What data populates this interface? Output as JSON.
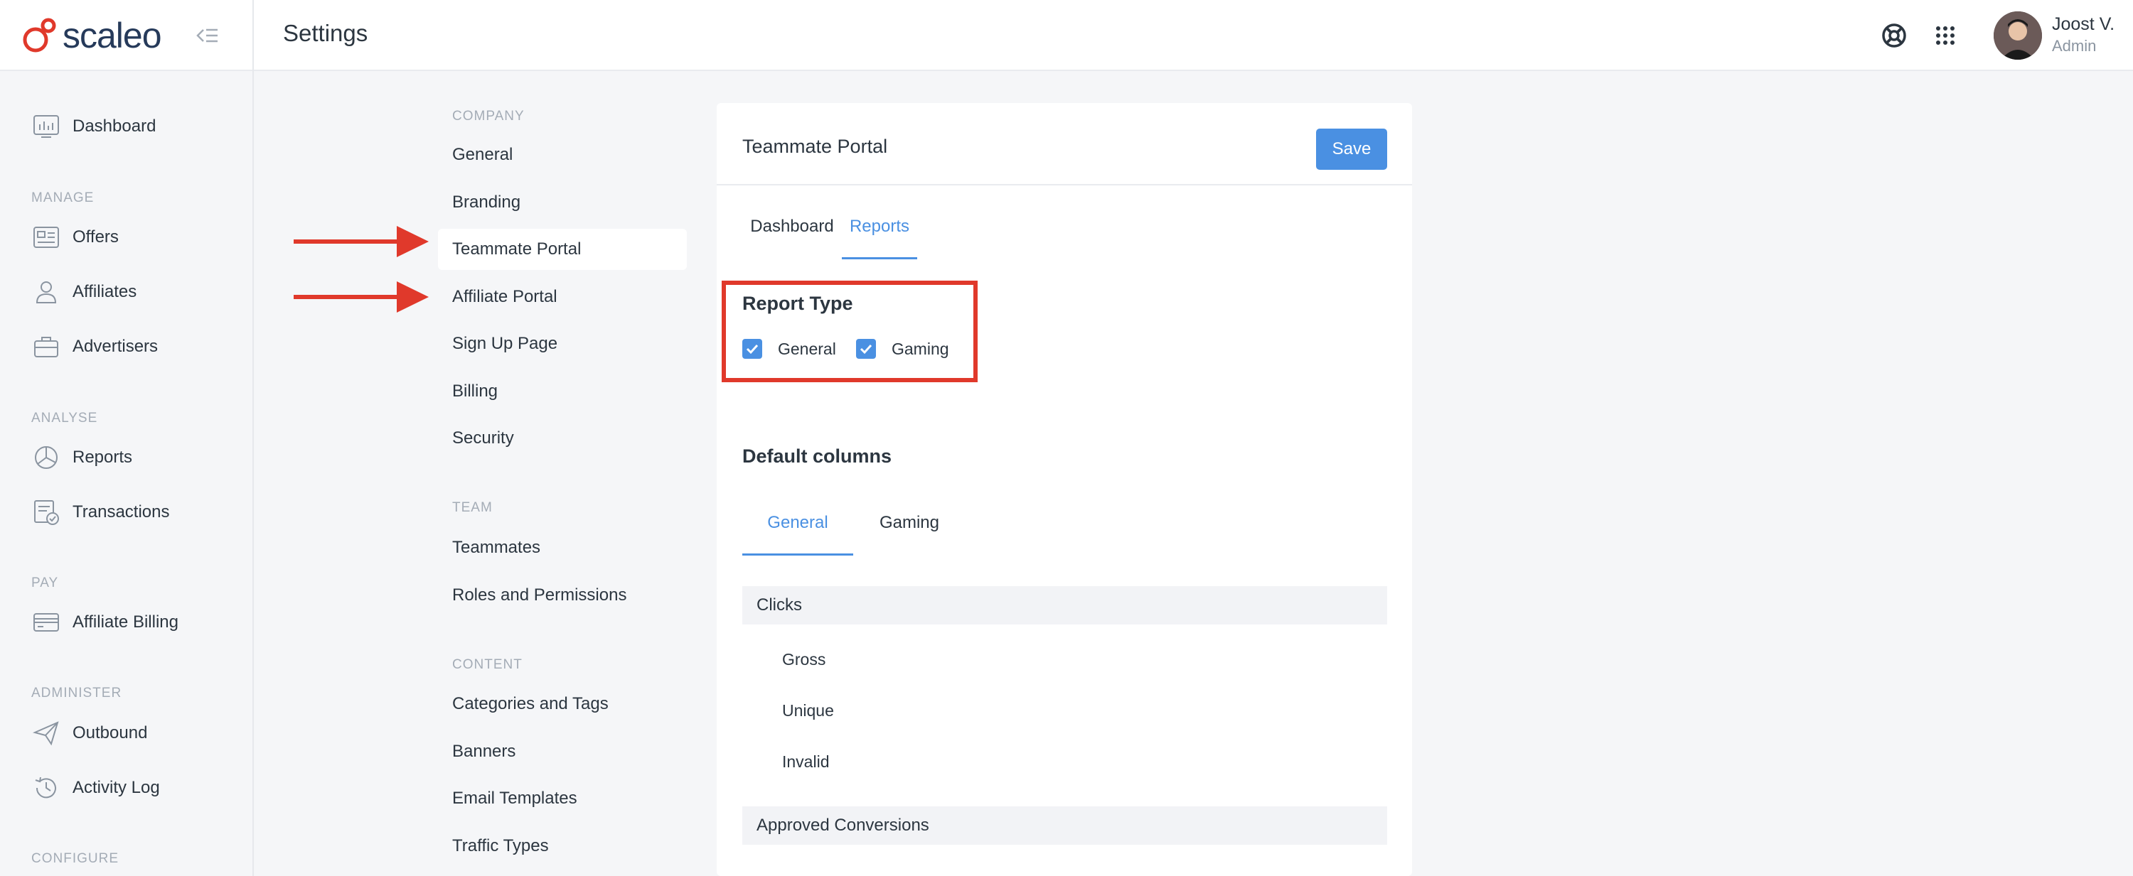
{
  "brand": {
    "name": "scaleo",
    "color": "#e0392b"
  },
  "header": {
    "title": "Settings"
  },
  "user": {
    "name": "Joost V.",
    "role": "Admin"
  },
  "sidebar": {
    "dashboard": "Dashboard",
    "sections": {
      "manage": "MANAGE",
      "analyse": "ANALYSE",
      "pay": "PAY",
      "administer": "ADMINISTER",
      "configure": "CONFIGURE"
    },
    "items": {
      "offers": "Offers",
      "affiliates": "Affiliates",
      "advertisers": "Advertisers",
      "reports": "Reports",
      "transactions": "Transactions",
      "affiliate_billing": "Affiliate Billing",
      "outbound": "Outbound",
      "activity_log": "Activity Log"
    }
  },
  "settings_nav": {
    "company_label": "COMPANY",
    "team_label": "TEAM",
    "content_label": "CONTENT",
    "general": "General",
    "branding": "Branding",
    "teammate_portal": "Teammate Portal",
    "affiliate_portal": "Affiliate Portal",
    "sign_up_page": "Sign Up Page",
    "billing": "Billing",
    "security": "Security",
    "teammates": "Teammates",
    "roles": "Roles and Permissions",
    "categories": "Categories and Tags",
    "banners": "Banners",
    "email_templates": "Email Templates",
    "traffic_types": "Traffic Types"
  },
  "card": {
    "title": "Teammate Portal",
    "save_label": "Save",
    "tabs": {
      "dashboard": "Dashboard",
      "reports": "Reports"
    },
    "report_type": {
      "title": "Report Type",
      "general": "General",
      "gaming": "Gaming",
      "general_checked": true,
      "gaming_checked": true
    },
    "default_columns": {
      "title": "Default columns",
      "tab_general": "General",
      "tab_gaming": "Gaming",
      "clicks_group": "Clicks",
      "clicks_items": [
        "Gross",
        "Unique",
        "Invalid"
      ],
      "approved_group": "Approved Conversions"
    }
  },
  "colors": {
    "accent": "#4a90e2",
    "highlight": "#e0392b"
  }
}
